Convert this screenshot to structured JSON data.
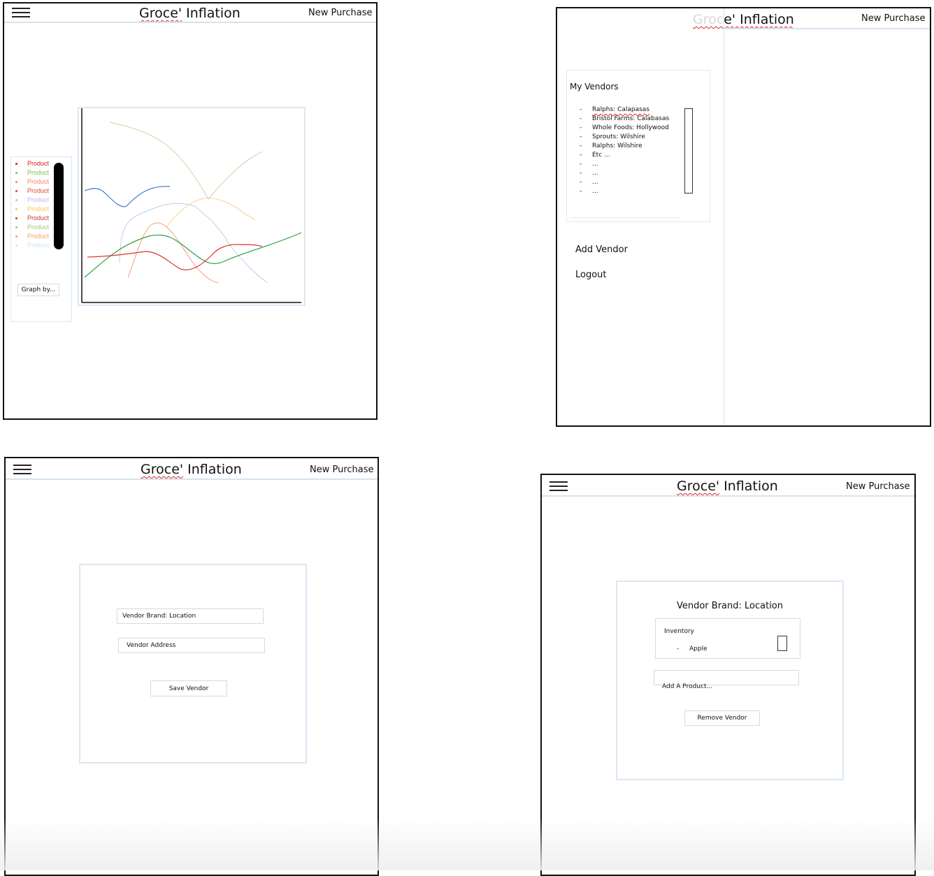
{
  "app": {
    "title_brand": "Groce'",
    "title_rest": " Inflation",
    "new_purchase": "New Purchase"
  },
  "dashboard": {
    "legend": [
      {
        "label": "Product",
        "color": "#d7191c"
      },
      {
        "label": "Product",
        "color": "#7ac143"
      },
      {
        "label": "Product",
        "color": "#f4845f"
      },
      {
        "label": "Product",
        "color": "#e8432e"
      },
      {
        "label": "Product",
        "color": "#c6b7dd"
      },
      {
        "label": "Product",
        "color": "#f7c948"
      },
      {
        "label": "Product",
        "color": "#c0392b"
      },
      {
        "label": "Product",
        "color": "#a0c878"
      },
      {
        "label": "Product",
        "color": "#f5a05a"
      },
      {
        "label": "Product",
        "color": "#cfe0f3"
      }
    ],
    "graph_by_button": "Graph by..."
  },
  "sidebar": {
    "my_vendors_title": "My Vendors",
    "vendors": [
      "Ralphs: Calapasas",
      "Bristol Farms: Calabasas",
      "Whole Foods: Hollywood",
      "Sprouts: Wilshire",
      "Ralphs: Wilshire",
      "Etc ...",
      "...",
      "...",
      "...",
      "..."
    ],
    "add_vendor": "Add Vendor",
    "logout": "Logout",
    "partial_title_hidden": "Groc",
    "partial_title_visible": "e' Inflation"
  },
  "add_vendor_form": {
    "brand_field": "Vendor Brand: Location",
    "address_field": "Vendor Address",
    "save_button": "Save Vendor"
  },
  "vendor_detail": {
    "heading": "Vendor Brand: Location",
    "inventory_label": "Inventory",
    "inventory_items": [
      "Apple"
    ],
    "add_product_placeholder": "Add A Product...",
    "remove_button": "Remove Vendor"
  }
}
